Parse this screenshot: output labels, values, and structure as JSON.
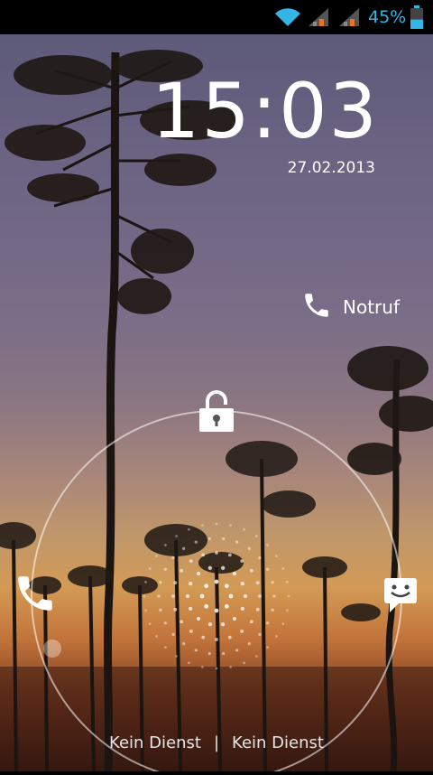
{
  "status_bar": {
    "battery_percent": "45%",
    "battery_level": 0.45,
    "wifi_icon": "wifi-icon",
    "signal_icons": [
      "signal-sim1-icon",
      "signal-sim2-icon"
    ],
    "accent_color": "#33b5e5"
  },
  "lockscreen": {
    "time": "15:03",
    "date": "27.02.2013",
    "emergency_label": "Notruf",
    "carrier_1": "Kein Dienst",
    "separator": "|",
    "carrier_2": "Kein Dienst",
    "targets": [
      "unlock-icon",
      "phone-icon",
      "message-icon"
    ]
  }
}
